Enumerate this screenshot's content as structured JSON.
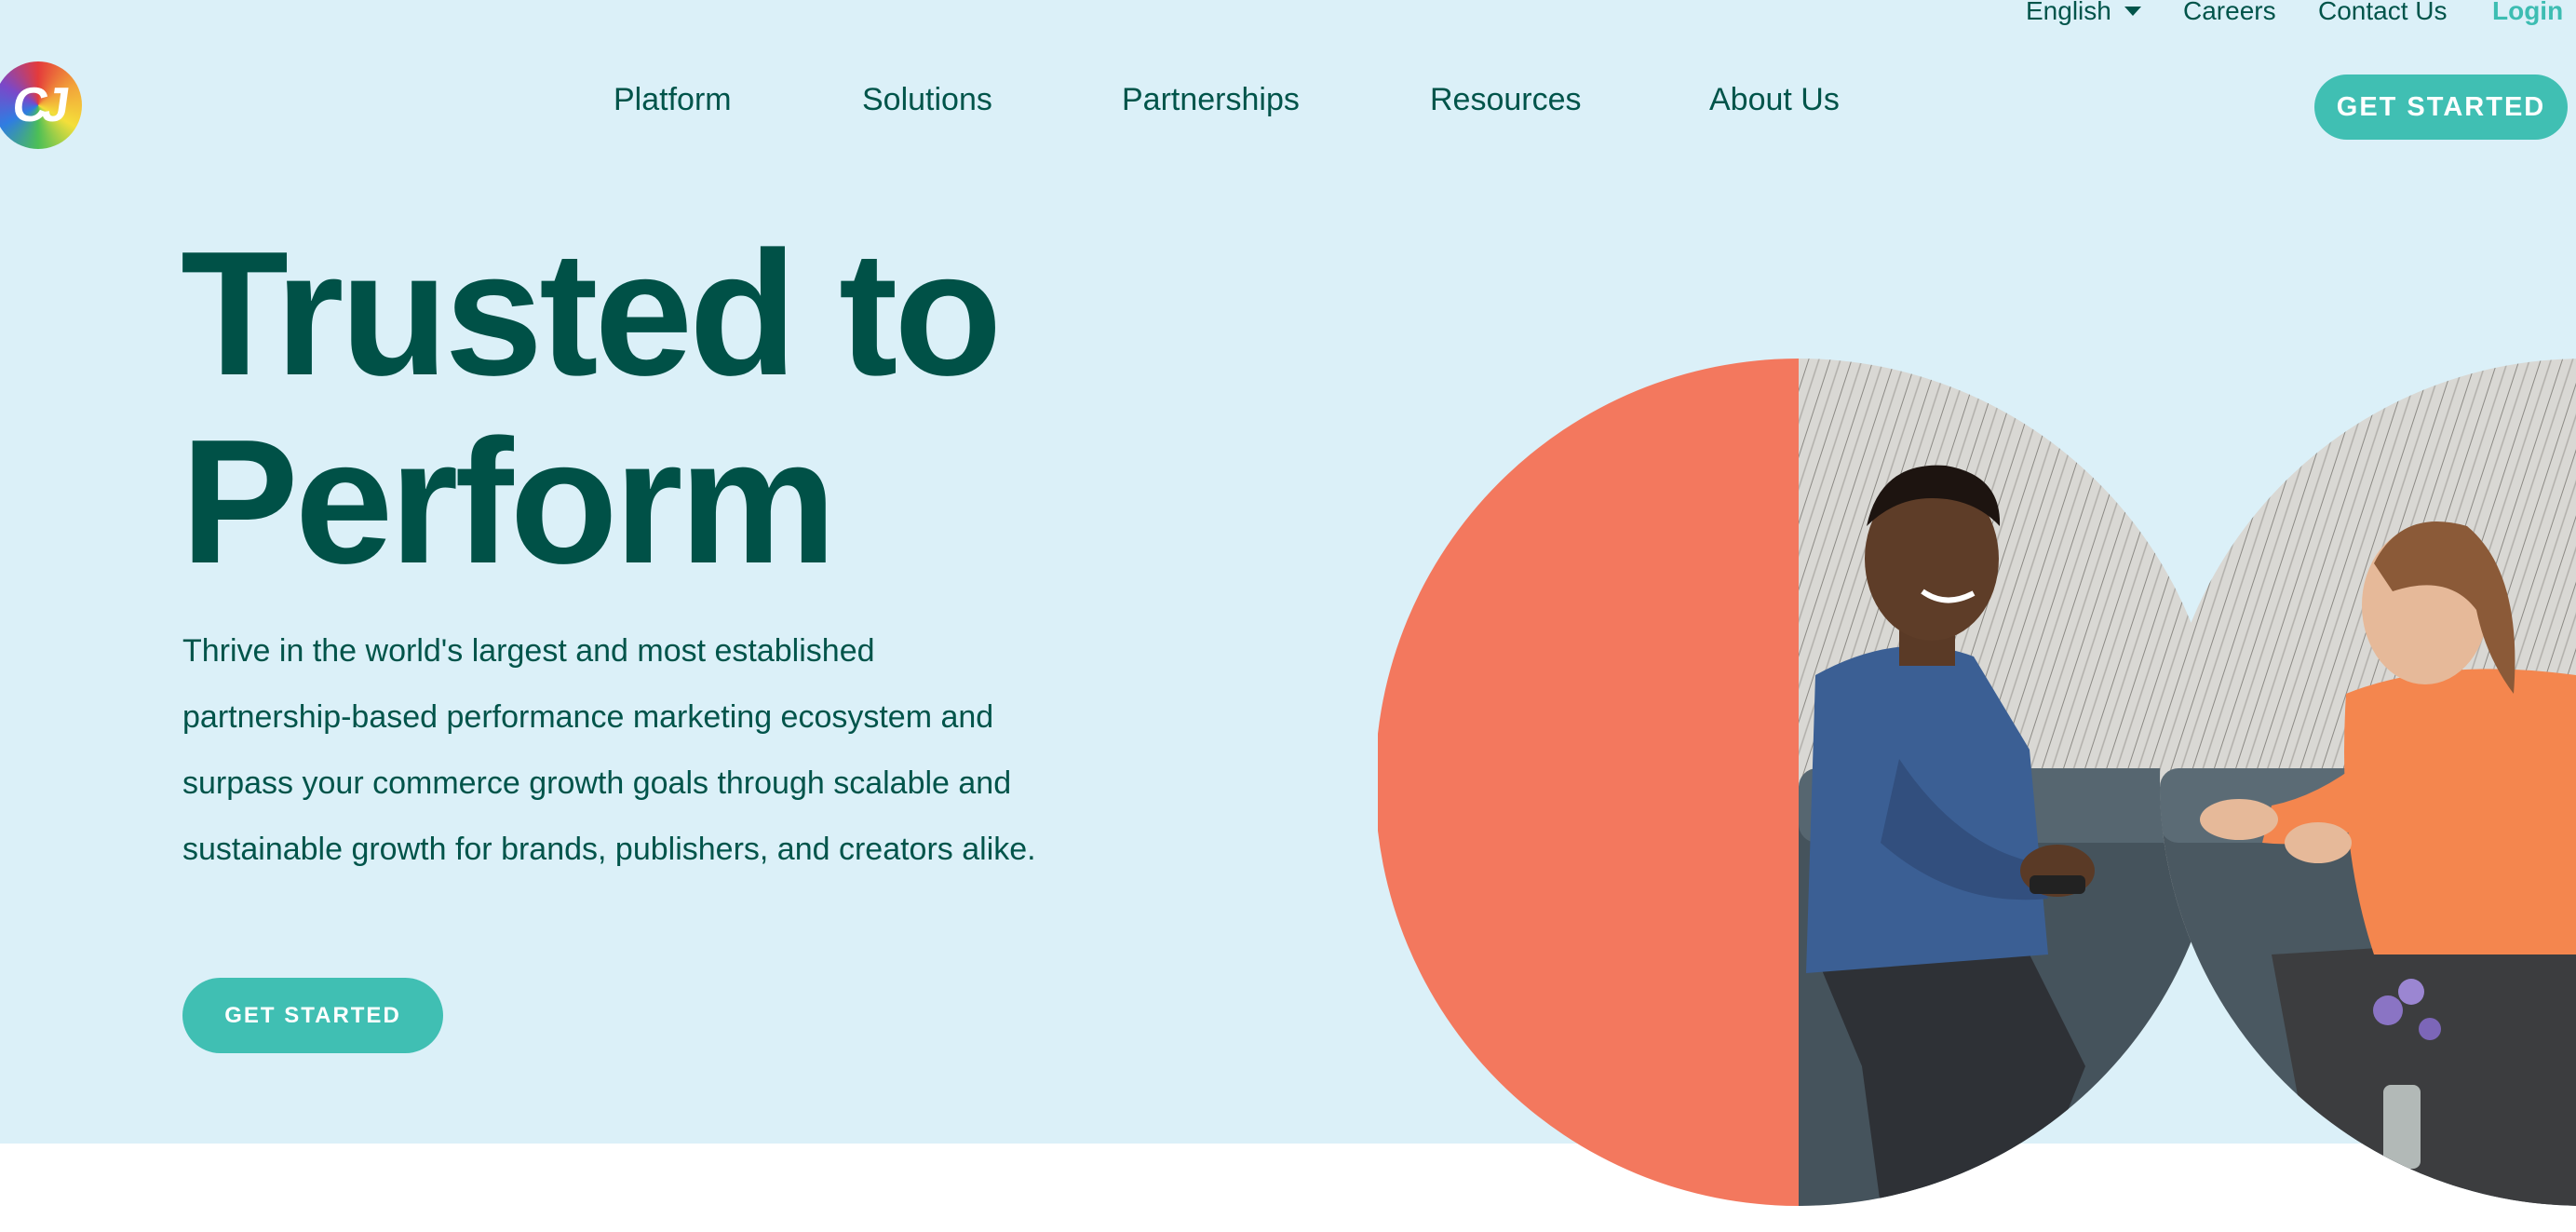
{
  "utility_nav": {
    "language": "English",
    "careers": "Careers",
    "contact": "Contact Us",
    "login": "Login"
  },
  "logo": {
    "text": "CJ"
  },
  "main_nav": {
    "items": [
      "Platform",
      "Solutions",
      "Partnerships",
      "Resources",
      "About Us"
    ]
  },
  "header_cta": "GET STARTED",
  "hero": {
    "headline_line1": "Trusted to",
    "headline_line2": "Perform",
    "subtext": "Thrive in the world's largest and most established partnership-based performance marketing ecosystem and surpass your commerce growth goals through scalable and sustainable growth for brands, publishers, and creators alike.",
    "cta": "GET STARTED"
  },
  "colors": {
    "hero_background": "#dbf0f8",
    "heading_text": "#005147",
    "accent_teal": "#40bfb3",
    "coral": "#f3785e"
  }
}
